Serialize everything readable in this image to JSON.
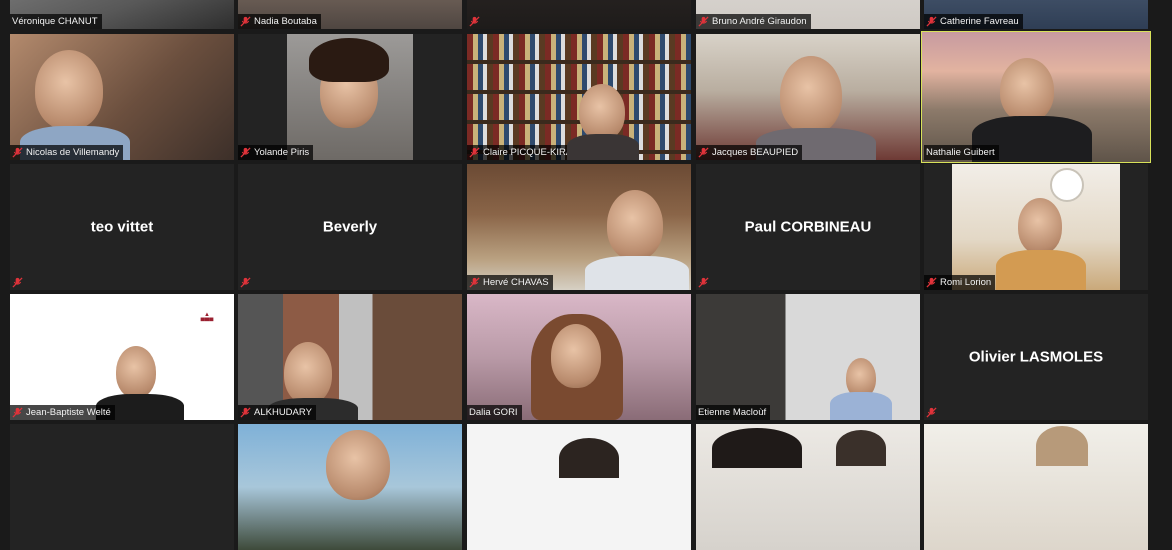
{
  "participants": [
    {
      "name": "Véronique CHANUT",
      "muted": true
    },
    {
      "name": "Nadia Boutaba",
      "muted": true
    },
    {
      "name": "",
      "muted": true
    },
    {
      "name": "Bruno André Giraudon",
      "muted": true
    },
    {
      "name": "Catherine Favreau",
      "muted": true
    },
    {
      "name": "Nicolas de Villemandy",
      "muted": true
    },
    {
      "name": "Yolande Piris",
      "muted": true
    },
    {
      "name": "Claire PICQUE-KIRALY",
      "muted": true
    },
    {
      "name": "Jacques BEAUPIED",
      "muted": true
    },
    {
      "name": "Nathalie Guibert",
      "muted": false,
      "active_speaker": true
    },
    {
      "name": "teo vittet",
      "muted": true,
      "video_off": true
    },
    {
      "name": "Beverly",
      "muted": true,
      "video_off": true
    },
    {
      "name": "Hervé CHAVAS",
      "muted": true
    },
    {
      "name": "Paul CORBINEAU",
      "muted": true,
      "video_off": true
    },
    {
      "name": "Romi Lorion",
      "muted": true
    },
    {
      "name": "Jean-Baptiste Welté",
      "muted": true
    },
    {
      "name": "ALKHUDARY",
      "muted": true
    },
    {
      "name": "Dalia GORI",
      "muted": false
    },
    {
      "name": "Etienne Macloùf",
      "muted": false
    },
    {
      "name": "Olivier LASMOLES",
      "muted": true,
      "video_off": true
    }
  ],
  "colors": {
    "active_outline": "#d8e25a",
    "muted_icon": "#e0333a",
    "tile_background": "#232323",
    "app_background": "#1a1a1a"
  },
  "icons": {
    "muted": "mic-muted-icon"
  }
}
